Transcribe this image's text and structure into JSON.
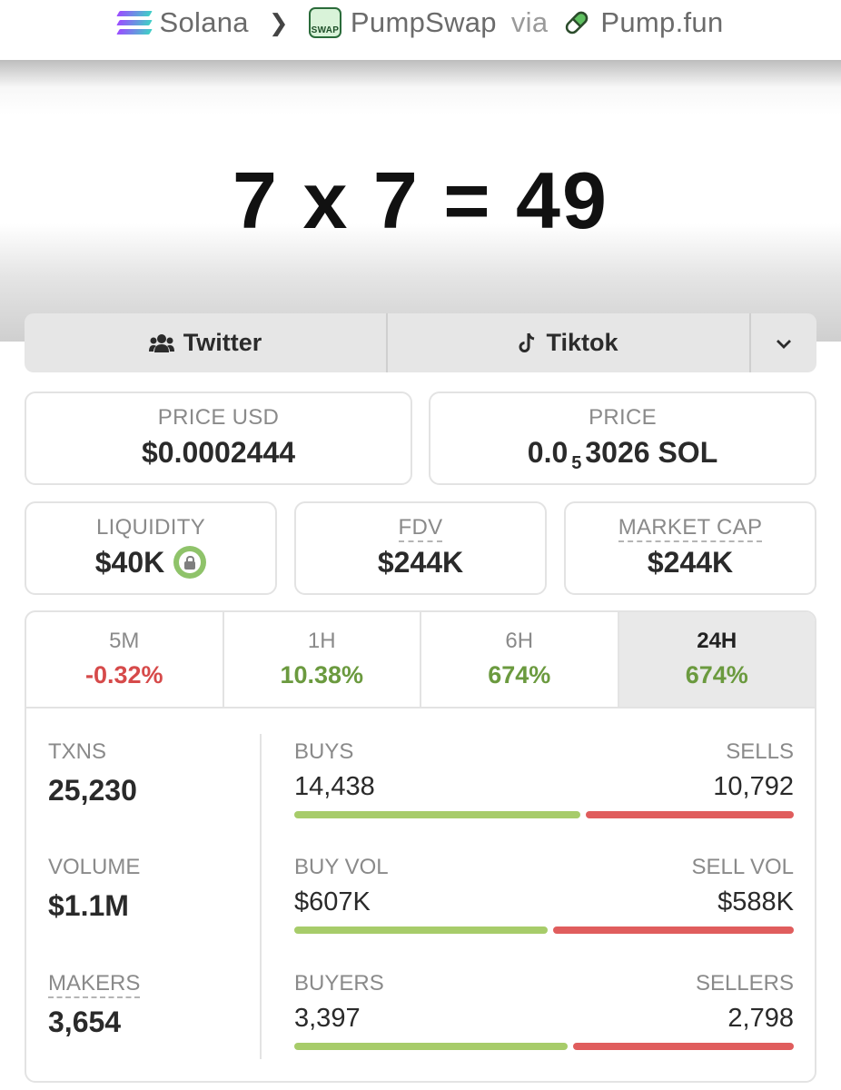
{
  "breadcrumb": {
    "chain": "Solana",
    "dex": "PumpSwap",
    "via": "via",
    "source": "Pump.fun",
    "swap_icon_text": "SWAP"
  },
  "banner": {
    "text": "7 x 7 = 49"
  },
  "social": {
    "twitter": "Twitter",
    "tiktok": "Tiktok"
  },
  "price": {
    "usd_label": "PRICE USD",
    "usd_value": "$0.0002444",
    "native_label": "PRICE",
    "native_prefix": "0.0",
    "native_sub": "5",
    "native_rest": "3026 SOL"
  },
  "metrics": {
    "liquidity_label": "LIQUIDITY",
    "liquidity_value": "$40K",
    "fdv_label": "FDV",
    "fdv_value": "$244K",
    "mcap_label": "MARKET CAP",
    "mcap_value": "$244K"
  },
  "timeframes": [
    {
      "label": "5M",
      "value": "-0.32%",
      "trend": "negative"
    },
    {
      "label": "1H",
      "value": "10.38%",
      "trend": "positive"
    },
    {
      "label": "6H",
      "value": "674%",
      "trend": "positive"
    },
    {
      "label": "24H",
      "value": "674%",
      "trend": "positive",
      "selected": true
    }
  ],
  "stats": {
    "txns_label": "TXNS",
    "txns_value": "25,230",
    "volume_label": "VOLUME",
    "volume_value": "$1.1M",
    "makers_label": "MAKERS",
    "makers_value": "3,654",
    "buys_label": "BUYS",
    "buys_value": "14,438",
    "buys_share": 0.572,
    "sells_label": "SELLS",
    "sells_value": "10,792",
    "buy_vol_label": "BUY VOL",
    "buy_vol_value": "$607K",
    "buy_vol_share": 0.508,
    "sell_vol_label": "SELL VOL",
    "sell_vol_value": "$588K",
    "buyers_label": "BUYERS",
    "buyers_value": "3,397",
    "buyers_share": 0.548,
    "sellers_label": "SELLERS",
    "sellers_value": "2,798"
  },
  "colors": {
    "positive": "#6b9a3f",
    "negative": "#d64a4a",
    "bar_buy": "#a7cc6a",
    "bar_sell": "#e05d5d"
  }
}
